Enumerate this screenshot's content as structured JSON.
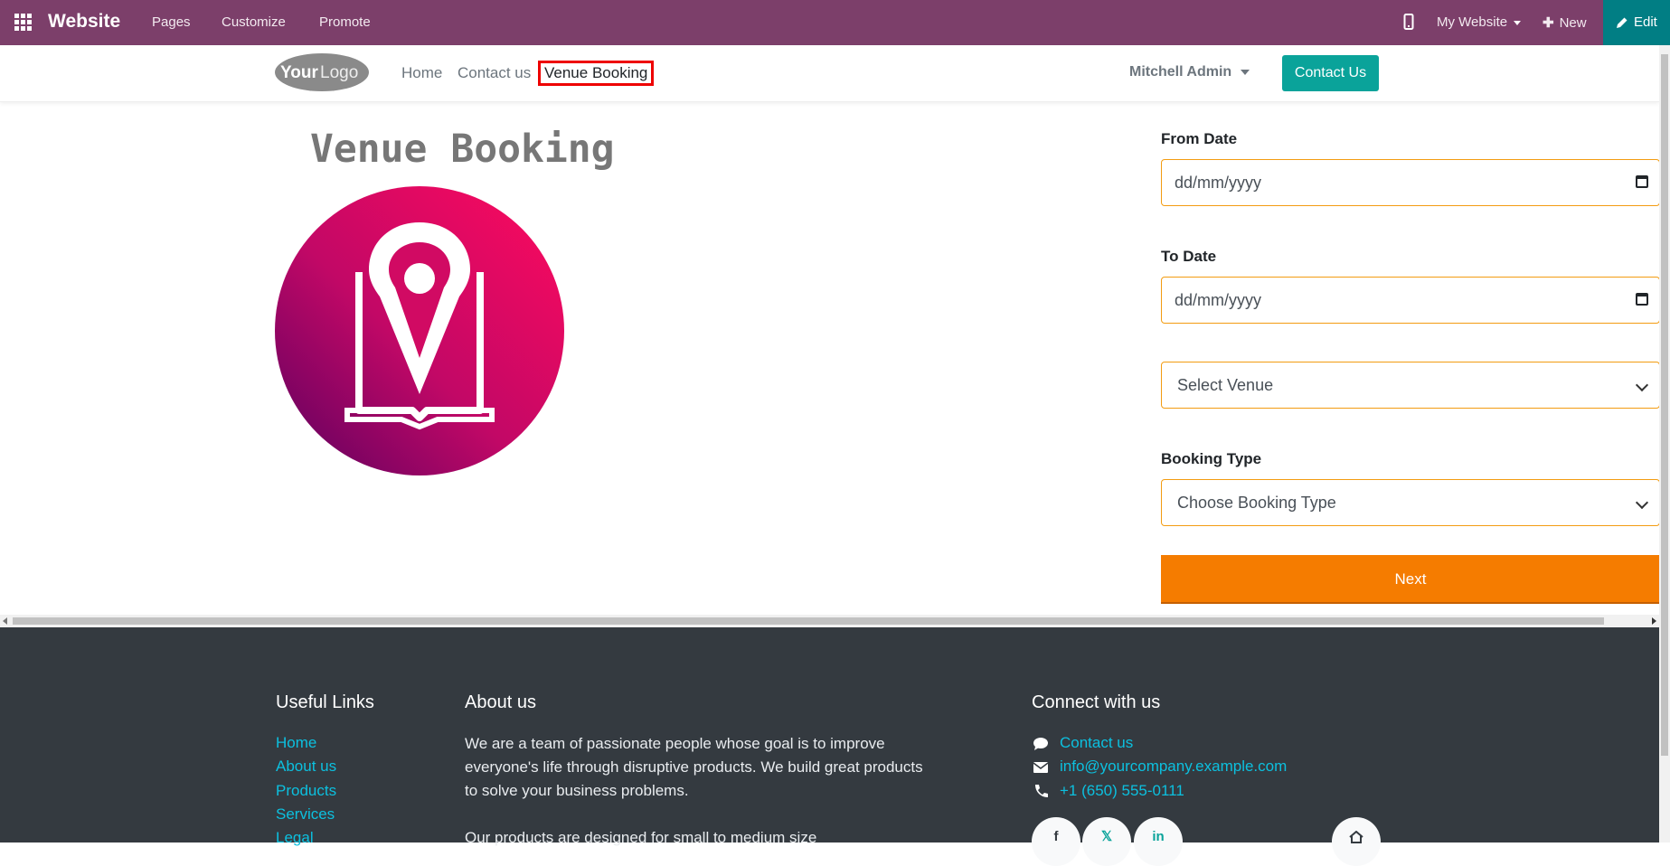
{
  "admin_bar": {
    "brand": "Website",
    "menu": [
      "Pages",
      "Customize",
      "Promote"
    ],
    "site_selector": "My Website",
    "new_label": "New",
    "edit_label": "Edit"
  },
  "header": {
    "logo_text": "YourLogo",
    "nav": [
      "Home",
      "Contact us",
      "Venue Booking"
    ],
    "user": "Mitchell Admin",
    "contact_button": "Contact Us"
  },
  "main": {
    "title": "Venue Booking",
    "from_date_label": "From Date",
    "from_date_placeholder": "dd/mm/yyyy",
    "to_date_label": "To Date",
    "to_date_placeholder": "dd/mm/yyyy",
    "venue_select": "Select Venue",
    "booking_type_label": "Booking Type",
    "booking_type_select": "Choose Booking Type",
    "next_button": "Next"
  },
  "footer": {
    "useful_links_title": "Useful Links",
    "useful_links": [
      "Home",
      "About us",
      "Products",
      "Services",
      "Legal"
    ],
    "about_title": "About us",
    "about_para1": "We are a team of passionate people whose goal is to improve everyone's life through disruptive products. We build great products to solve your business problems.",
    "about_para2": "Our products are designed for small to medium size",
    "connect_title": "Connect with us",
    "contact_link": "Contact us",
    "email": "info@yourcompany.example.com",
    "phone": "+1 (650) 555-0111",
    "social": [
      "f",
      "𝕏",
      "in"
    ]
  },
  "colors": {
    "admin_bar": "#7C3F6A",
    "edit_button": "#017E84",
    "contact_button": "#0AA39A",
    "next_button": "#F57C00",
    "field_border": "#F39C12",
    "footer_bg": "#343A40",
    "footer_link": "#0CC0DF"
  }
}
